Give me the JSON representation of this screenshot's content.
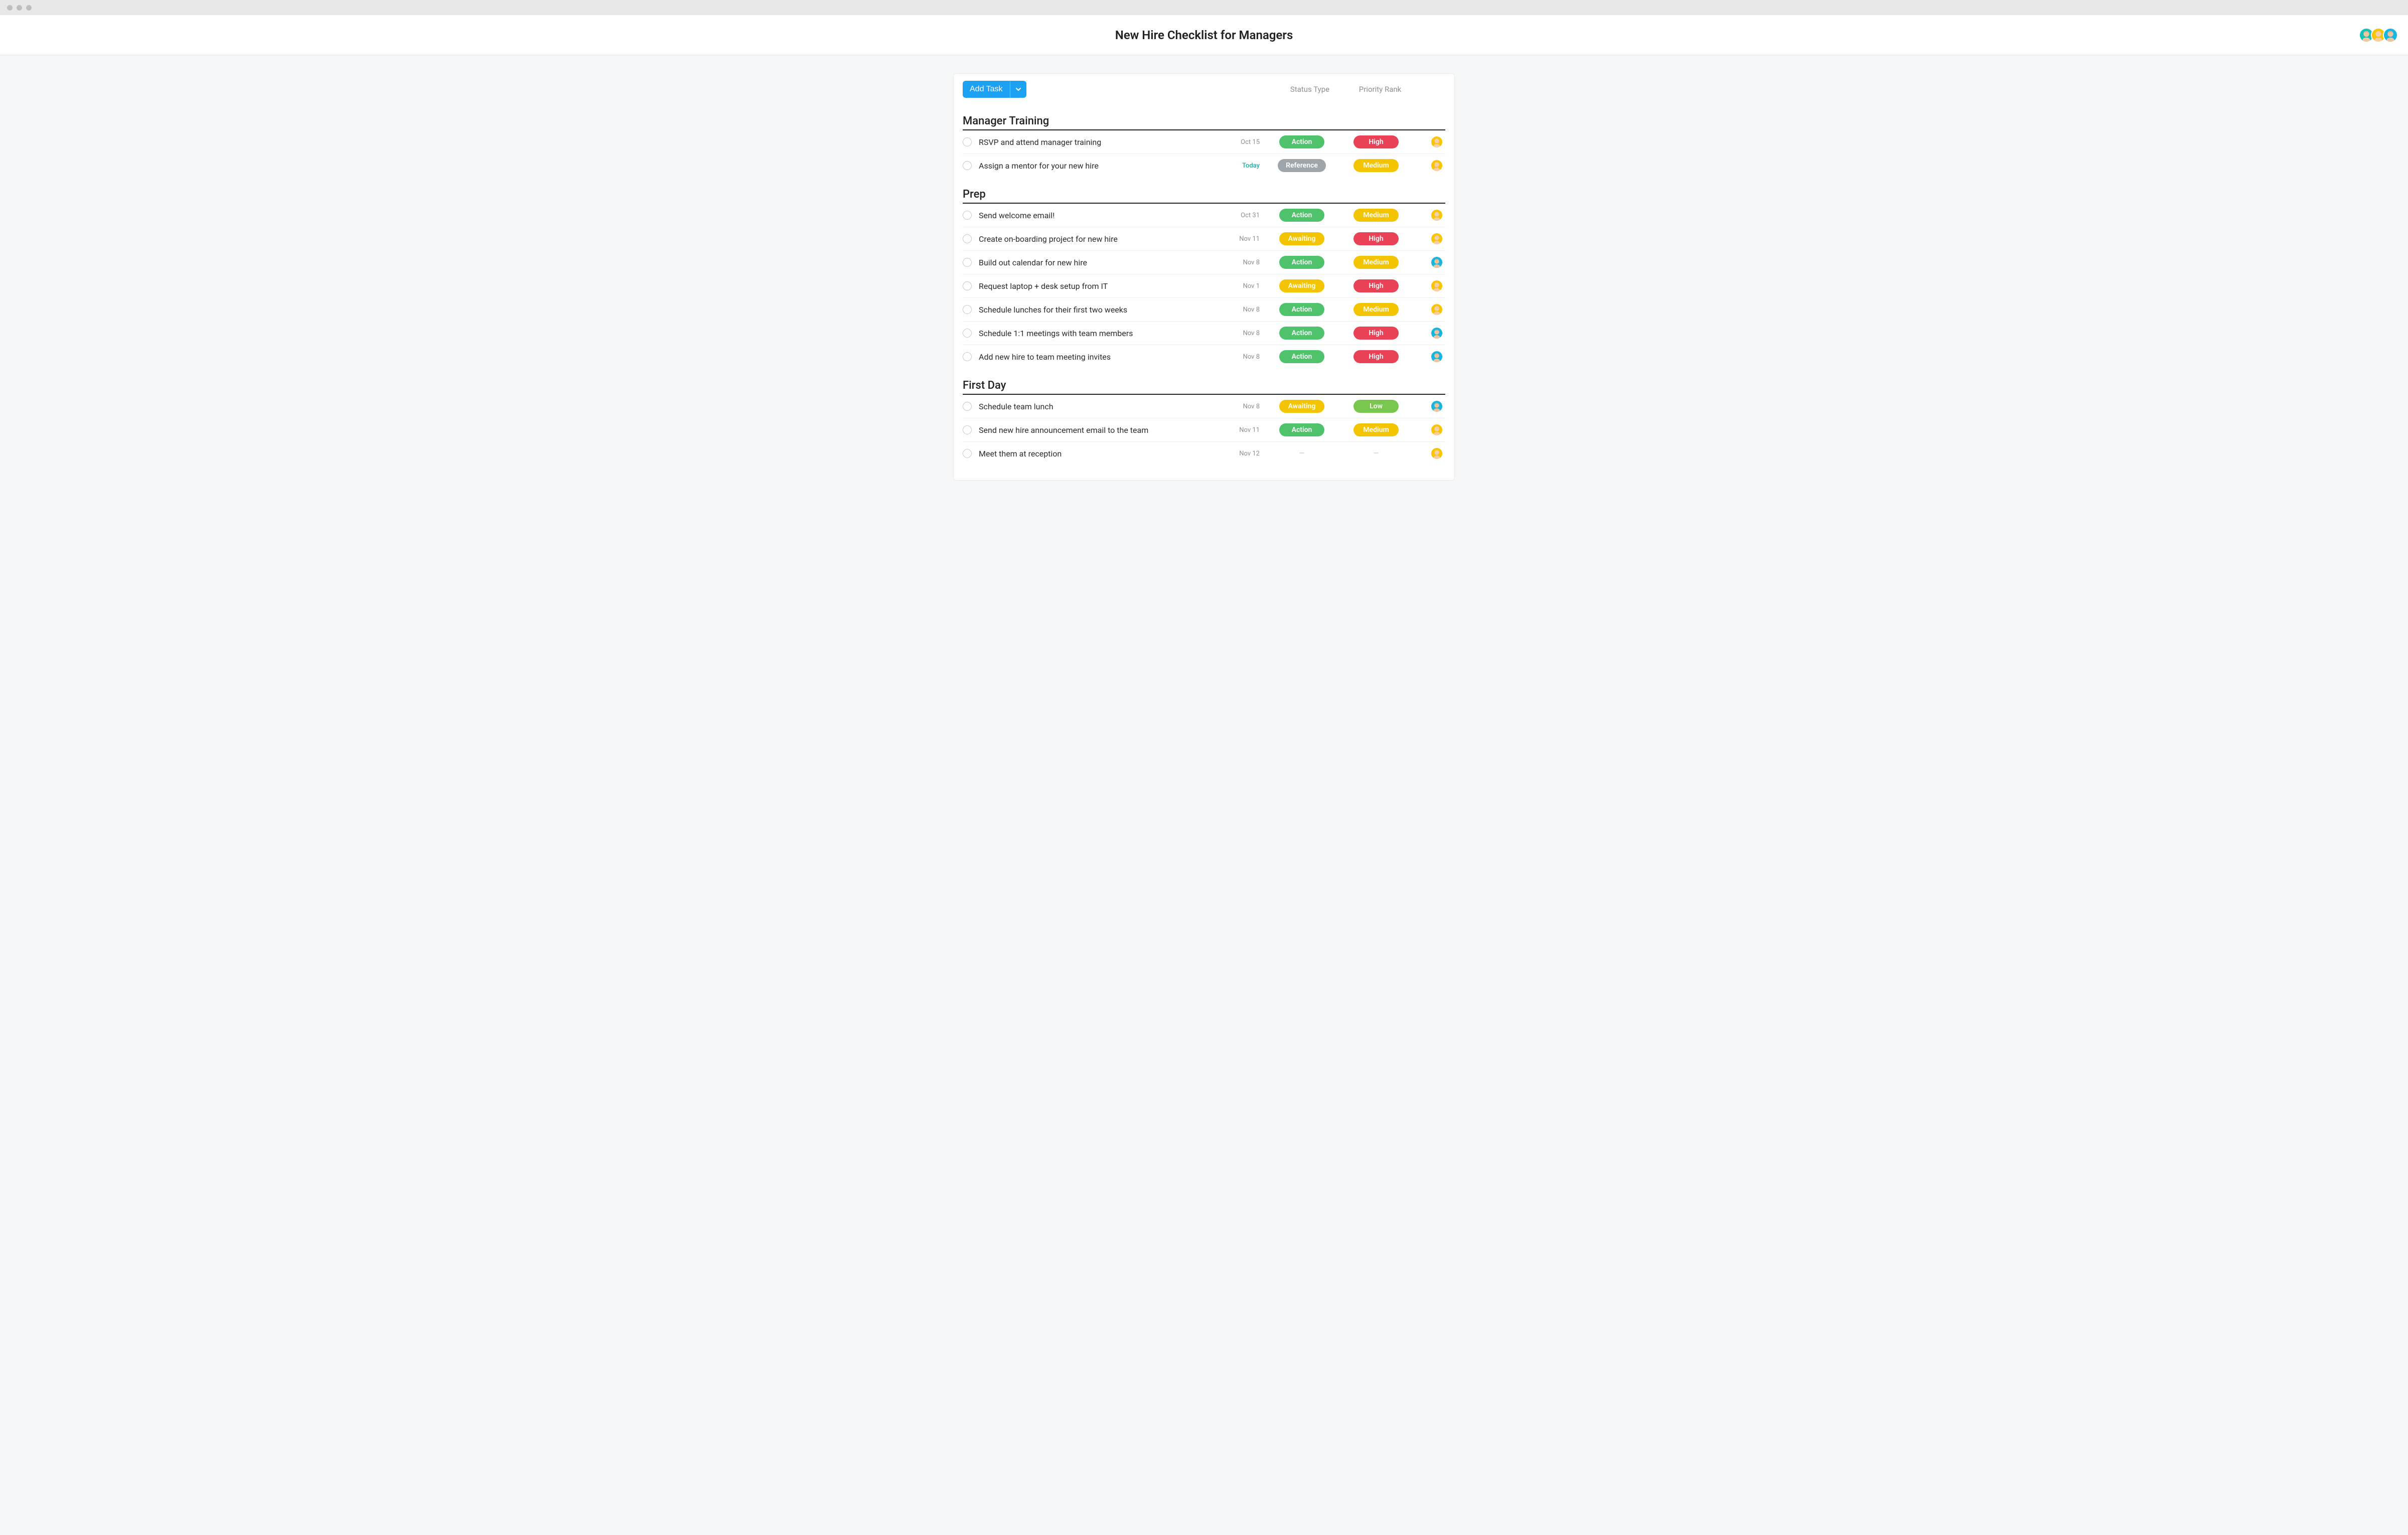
{
  "header": {
    "title": "New Hire Checklist for Managers",
    "avatars": [
      "teal-1",
      "yellow-1",
      "cyan-1"
    ]
  },
  "toolbar": {
    "add_task_label": "Add Task"
  },
  "columns": {
    "status": "Status Type",
    "priority": "Priority Rank"
  },
  "palette": {
    "status": {
      "Action": "#4fc36b",
      "Reference": "#9ea5ab",
      "Awaiting": "#f3c400"
    },
    "priority": {
      "High": "#e94256",
      "Medium": "#f3c400",
      "Low": "#7ac74f"
    }
  },
  "avatars": {
    "teal-1": {
      "bg": "#14c3b7",
      "hair": "#6b3a1f",
      "skin": "#f2c9a3"
    },
    "yellow-1": {
      "bg": "#f9c400",
      "hair": "#e9d27a",
      "skin": "#f4cfa8"
    },
    "cyan-1": {
      "bg": "#17b6e0",
      "hair": "#5a4334",
      "skin": "#eec49c"
    }
  },
  "sections": [
    {
      "title": "Manager Training",
      "tasks": [
        {
          "name": "RSVP and attend manager training",
          "date": "Oct 15",
          "status": "Action",
          "priority": "High",
          "avatar": "yellow-1"
        },
        {
          "name": "Assign a mentor for your new hire",
          "date": "Today",
          "status": "Reference",
          "priority": "Medium",
          "avatar": "yellow-1",
          "dateHighlight": true
        }
      ]
    },
    {
      "title": "Prep",
      "tasks": [
        {
          "name": "Send welcome email!",
          "date": "Oct 31",
          "status": "Action",
          "priority": "Medium",
          "avatar": "yellow-1"
        },
        {
          "name": "Create on-boarding project for new hire",
          "date": "Nov 11",
          "status": "Awaiting",
          "priority": "High",
          "avatar": "yellow-1"
        },
        {
          "name": "Build out calendar for new hire",
          "date": "Nov 8",
          "status": "Action",
          "priority": "Medium",
          "avatar": "cyan-1"
        },
        {
          "name": "Request laptop + desk setup from IT",
          "date": "Nov 1",
          "status": "Awaiting",
          "priority": "High",
          "avatar": "yellow-1"
        },
        {
          "name": "Schedule lunches for their first two weeks",
          "date": "Nov 8",
          "status": "Action",
          "priority": "Medium",
          "avatar": "yellow-1"
        },
        {
          "name": "Schedule 1:1 meetings with team members",
          "date": "Nov 8",
          "status": "Action",
          "priority": "High",
          "avatar": "cyan-1"
        },
        {
          "name": "Add new hire to team meeting invites",
          "date": "Nov 8",
          "status": "Action",
          "priority": "High",
          "avatar": "cyan-1"
        }
      ]
    },
    {
      "title": "First Day",
      "tasks": [
        {
          "name": "Schedule team lunch",
          "date": "Nov 8",
          "status": "Awaiting",
          "priority": "Low",
          "avatar": "cyan-1"
        },
        {
          "name": "Send new hire announcement email to the team",
          "date": "Nov 11",
          "status": "Action",
          "priority": "Medium",
          "avatar": "yellow-1"
        },
        {
          "name": "Meet them at reception",
          "date": "Nov 12",
          "status": null,
          "priority": null,
          "avatar": "yellow-1"
        }
      ]
    }
  ]
}
